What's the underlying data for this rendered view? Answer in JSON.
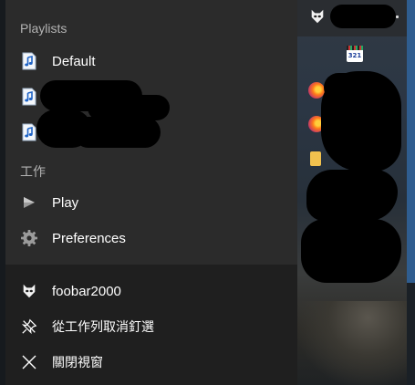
{
  "jumplist": {
    "sections": {
      "playlists_label": "Playlists",
      "tasks_label": "工作"
    },
    "playlists": [
      {
        "label": "Default",
        "icon": "music-file-icon"
      },
      {
        "label": "",
        "icon": "music-file-icon"
      },
      {
        "label": "",
        "icon": "music-file-icon"
      }
    ],
    "tasks": [
      {
        "label": "Play",
        "icon": "play-icon"
      },
      {
        "label": "Preferences",
        "icon": "gear-icon"
      }
    ],
    "footer": [
      {
        "label": "foobar2000",
        "icon": "foobar-app-icon"
      },
      {
        "label": "從工作列取消釘選",
        "icon": "unpin-icon"
      },
      {
        "label": "關閉視窗",
        "icon": "close-icon"
      }
    ]
  },
  "background": {
    "taskbar_app_icon": "foobar-app-icon",
    "desktop_icons": [
      "counter-321-icon",
      "firefox-icon",
      "firefox-icon",
      "folder-icon"
    ],
    "counter_text": "321"
  },
  "colors": {
    "menu_bg": "#2b2b2b",
    "footer_bg": "#1f1f1f",
    "text": "#ffffff",
    "section_text": "#b3b3b3"
  }
}
